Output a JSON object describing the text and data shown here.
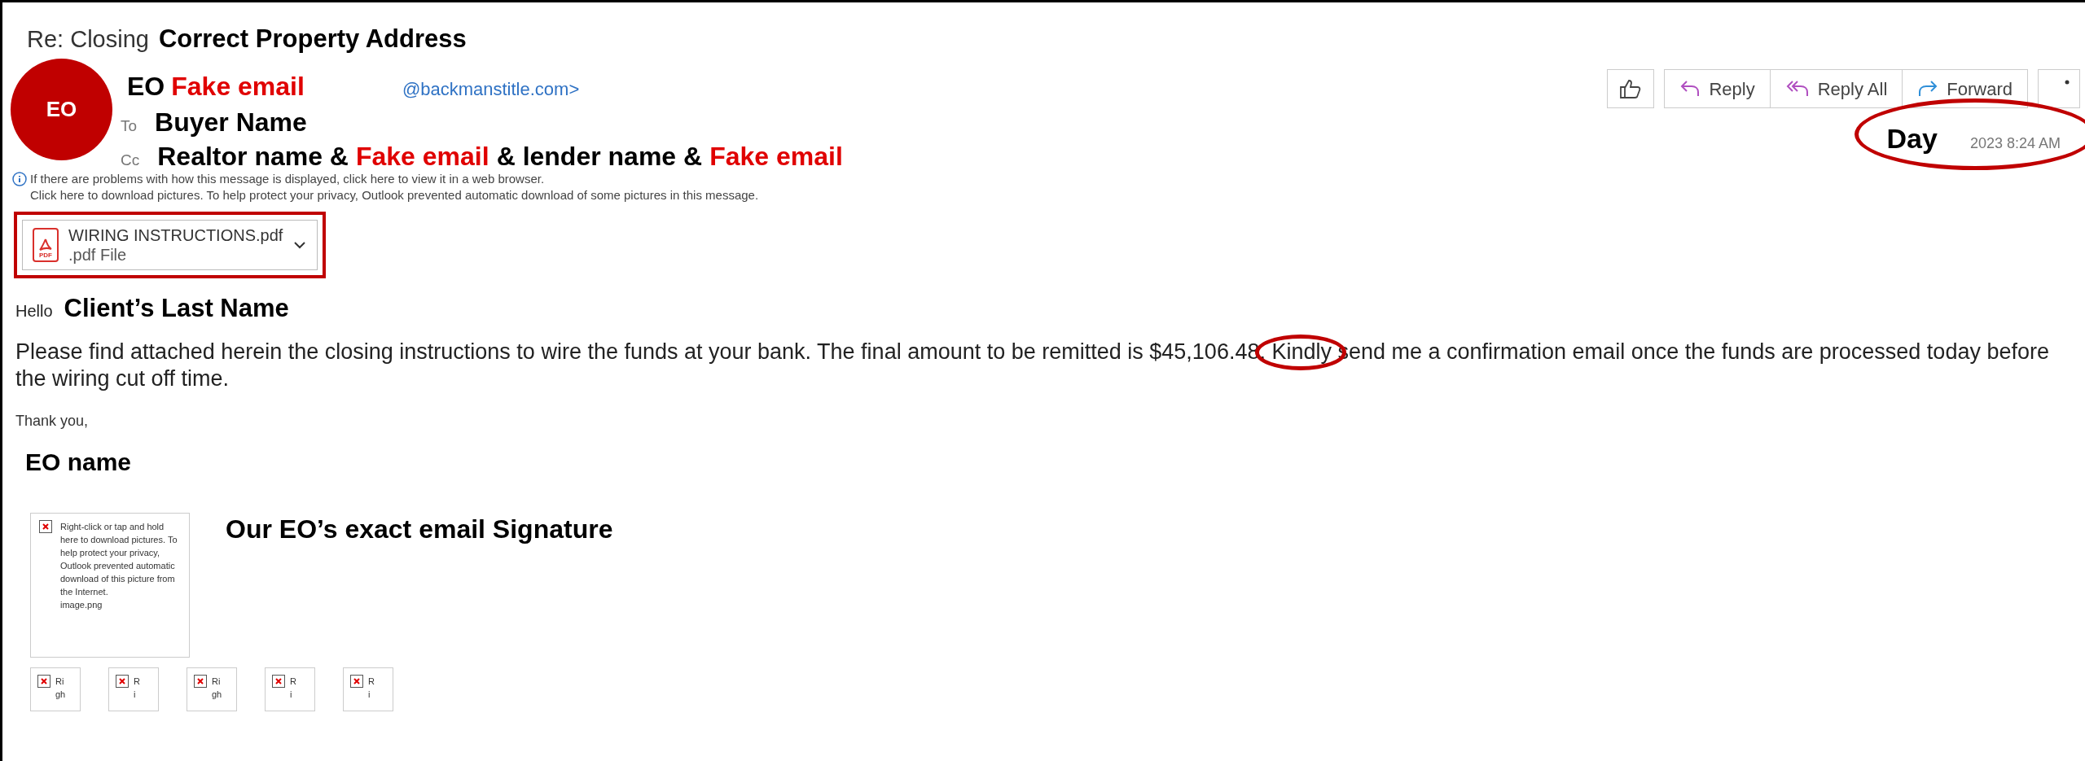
{
  "subject": {
    "text": "Re: Closing",
    "annotation": "Correct Property Address"
  },
  "sender": {
    "avatar": "EO",
    "name_parts": [
      {
        "text": "EO",
        "color": "#000000"
      },
      {
        "text": "Fake email",
        "color": "#e00000"
      }
    ],
    "address": "@backmanstitle.com>"
  },
  "to": {
    "label": "To",
    "annotation": "Buyer Name"
  },
  "cc": {
    "label": "Cc",
    "parts": [
      {
        "text": "Realtor name &",
        "color": "#000000"
      },
      {
        "text": "Fake email",
        "color": "#e00000"
      },
      {
        "text": "& lender name &",
        "color": "#000000"
      },
      {
        "text": "Fake email",
        "color": "#e00000"
      }
    ]
  },
  "info": [
    "If there are problems with how this message is displayed, click here to view it in a web browser.",
    "Click here to download pictures. To help protect your privacy, Outlook prevented automatic download of some pictures in this message."
  ],
  "attachment": {
    "name": "WIRING INSTRUCTIONS.pdf",
    "type": ".pdf File",
    "icon_label": "PDF",
    "highlighted": true
  },
  "actions": [
    {
      "kind": "like"
    },
    {
      "kind": "reply",
      "label": "Reply"
    },
    {
      "kind": "reply_all",
      "label": "Reply All"
    },
    {
      "kind": "forward",
      "label": "Forward"
    },
    {
      "kind": "more"
    }
  ],
  "date": {
    "annotation": "Day",
    "text": "2023 8:24 AM",
    "highlighted": true
  },
  "greeting": {
    "text": "Hello",
    "annotation": "Client’s Last Name"
  },
  "body": {
    "text": "Please find attached herein the closing instructions to wire the funds at your bank. The final amount to be remitted is $45,106.48. Kindly send me a confirmation email once the funds are processed today before the wiring cut off time.",
    "highlighted": true
  },
  "closing": "Thank you,",
  "signer_annotation": "EO name",
  "signature_image": {
    "text": "Right-click or tap and hold here to download pictures. To help protect your privacy, Outlook prevented automatic download of this picture from the Internet.",
    "filename": "image.png"
  },
  "signature_annotation": "Our EO’s exact email Signature",
  "small_images": [
    {
      "lines": [
        "Ri",
        "gh"
      ]
    },
    {
      "lines": [
        "R",
        "i"
      ]
    },
    {
      "lines": [
        "Ri",
        "gh"
      ]
    },
    {
      "lines": [
        "R",
        "i"
      ]
    },
    {
      "lines": [
        "R",
        "i"
      ]
    }
  ]
}
